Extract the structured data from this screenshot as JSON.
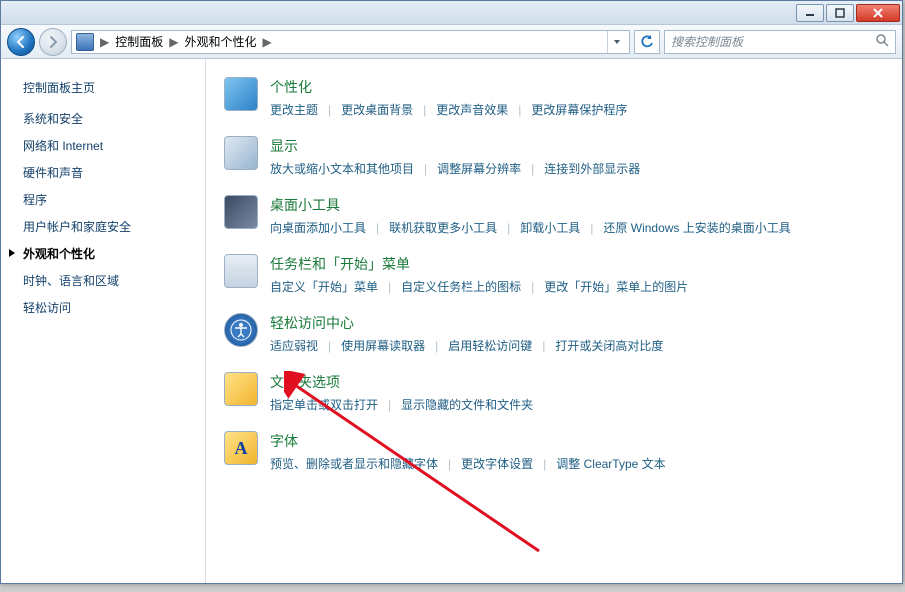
{
  "breadcrumb": {
    "root": "控制面板",
    "current": "外观和个性化"
  },
  "search": {
    "placeholder": "搜索控制面板"
  },
  "sidebar": {
    "home": "控制面板主页",
    "items": [
      {
        "label": "系统和安全"
      },
      {
        "label": "网络和 Internet"
      },
      {
        "label": "硬件和声音"
      },
      {
        "label": "程序"
      },
      {
        "label": "用户帐户和家庭安全"
      },
      {
        "label": "外观和个性化",
        "active": true
      },
      {
        "label": "时钟、语言和区域"
      },
      {
        "label": "轻松访问"
      }
    ]
  },
  "categories": [
    {
      "icon": "personalization-icon",
      "title": "个性化",
      "links": [
        "更改主题",
        "更改桌面背景",
        "更改声音效果",
        "更改屏幕保护程序"
      ]
    },
    {
      "icon": "display-icon",
      "title": "显示",
      "links": [
        "放大或缩小文本和其他项目",
        "调整屏幕分辨率",
        "连接到外部显示器"
      ]
    },
    {
      "icon": "gadgets-icon",
      "title": "桌面小工具",
      "links": [
        "向桌面添加小工具",
        "联机获取更多小工具",
        "卸载小工具",
        "还原 Windows 上安装的桌面小工具"
      ]
    },
    {
      "icon": "taskbar-icon",
      "title": "任务栏和「开始」菜单",
      "links": [
        "自定义「开始」菜单",
        "自定义任务栏上的图标",
        "更改「开始」菜单上的图片"
      ]
    },
    {
      "icon": "ease-icon",
      "title": "轻松访问中心",
      "links": [
        "适应弱视",
        "使用屏幕读取器",
        "启用轻松访问键",
        "打开或关闭高对比度"
      ]
    },
    {
      "icon": "folder-icon",
      "title": "文件夹选项",
      "links": [
        "指定单击或双击打开",
        "显示隐藏的文件和文件夹"
      ]
    },
    {
      "icon": "fonts-icon",
      "title": "字体",
      "links": [
        "预览、删除或者显示和隐藏字体",
        "更改字体设置",
        "调整 ClearType 文本"
      ]
    }
  ]
}
